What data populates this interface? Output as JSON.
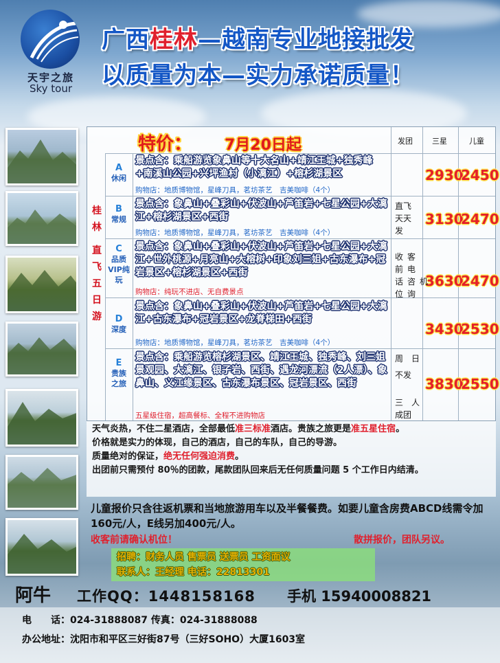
{
  "logo": {
    "cn": "天宇之旅",
    "en": "Sky tour"
  },
  "headline1": {
    "part1": "广西",
    "part2": "桂林",
    "part3": "—越南专业地接批发"
  },
  "headline2": "以质量为本—实力承诺质量！",
  "table": {
    "title": "特价：",
    "date": "7月20日起",
    "col_departure": "发团",
    "col_three_star": "三星",
    "col_child": "儿童",
    "region_chars": [
      "桂",
      "林",
      "直",
      "飞",
      "五",
      "日",
      "游"
    ],
    "routes": [
      {
        "code": "A",
        "name": "休闲",
        "spots": "景点含：乘船游览象鼻山等十大名山+靖江王城+独秀峰+南溪山公园+兴坪渔村（小漓江）+榕杉湖景区",
        "shop": "购物店：地质博物馆，星峰刀具，茗坊茶艺　吉美咖啡（4个）",
        "price_three_star": "2930",
        "price_child": "2450"
      },
      {
        "code": "B",
        "name": "常规",
        "spots": "景点含：象鼻山+叠彩山+伏波山+芦笛岩+七星公园+大漓江+榕杉湖景区+西街",
        "shop": "购物店：地质博物馆，星峰刀具，茗坊茶艺　吉美咖啡（4个）",
        "price_three_star": "3130",
        "price_child": "2470"
      },
      {
        "code": "C",
        "name": "品质VIP纯玩",
        "spots": "景点含：象鼻山+叠彩山+伏波山+芦笛岩+七星公园+大漓江+世外桃源+月亮山+大榕树+印象刘三姐+古东瀑布+冠岩景区+榕杉湖景区+西街",
        "shop": "购物店：纯玩不进店、无自费景点",
        "price_three_star": "3630",
        "price_child": "2470"
      },
      {
        "code": "D",
        "name": "深度",
        "spots": "景点含：象鼻山+叠彩山+伏波山+芦笛岩+七星公园+大漓江+古东瀑布+冠岩景区+龙脊梯田+西街",
        "shop": "购物店：地质博物馆，星峰刀具，茗坊茶艺　吉美咖啡（4个）",
        "price_three_star": "3430",
        "price_child": "2530"
      },
      {
        "code": "E",
        "name": "贵族之旅",
        "spots": "景点含：乘船游览榕杉湖景区、靖江王城、独秀峰、刘三姐景观园、大漓江、银子岩、西街、遇龙河漂流（2人漂）、象鼻山、义江缘景区、古东瀑布景区、冠岩景区、西街",
        "shop": "五星级住宿，超高餐标、全程不进购物店",
        "price_three_star": "3830",
        "price_child": "2550"
      }
    ],
    "departure": {
      "daily": [
        "直飞",
        "天天",
        "发"
      ],
      "call_left": [
        "收",
        "前",
        "话",
        "位"
      ],
      "call_mid": [
        "客",
        "电",
        "咨",
        "询"
      ],
      "call_right": [
        "机"
      ],
      "friday": [
        "周　日",
        "不发"
      ],
      "three_people": [
        "三　人",
        "成团"
      ]
    }
  },
  "notes": {
    "line1_a": "天气炎热，不住二星酒店，全部最低",
    "line1_b": "准三标准",
    "line1_c": "酒店。贵族之旅更是",
    "line1_d": "准五星住宿",
    "line1_e": "。",
    "line2": "价格就是实力的体现，自己的酒店，自己的车队，自己的导游。",
    "line3_a": "质量绝对的保证，",
    "line3_b": "绝无任何强迫消费",
    "line3_c": "。",
    "line4": "出团前只需预付 80％的团款，尾款团队回来后无任何质量问题 5 个工作日内结清。"
  },
  "child_note": "儿童报价只含往返机票和当地旅游用车以及半餐餐费。如要儿童含房费ABCD线需令加160元/人，E线另加400元/人。",
  "confirm": "收客前请确认机位！",
  "loose": "散拼报价，团队另议。",
  "recruit": {
    "line1": "招聘：财务人员 售票员 送票员 工资面议",
    "line2": "联系人：王经理 电话：22813301"
  },
  "contact": {
    "name": "阿牛",
    "qq": "工作QQ：1448158168",
    "mobile": "手机 15940008821"
  },
  "footer": {
    "phone": "电　　话：024-31888087 传真：024-31888088",
    "address": "办公地址：沈阳市和平区三好街87号（三好SOHO）大厦1603室"
  },
  "colors": {
    "headline_blue": "#1457c6",
    "accent_red": "#e0202d",
    "price_red": "#e3202a"
  }
}
